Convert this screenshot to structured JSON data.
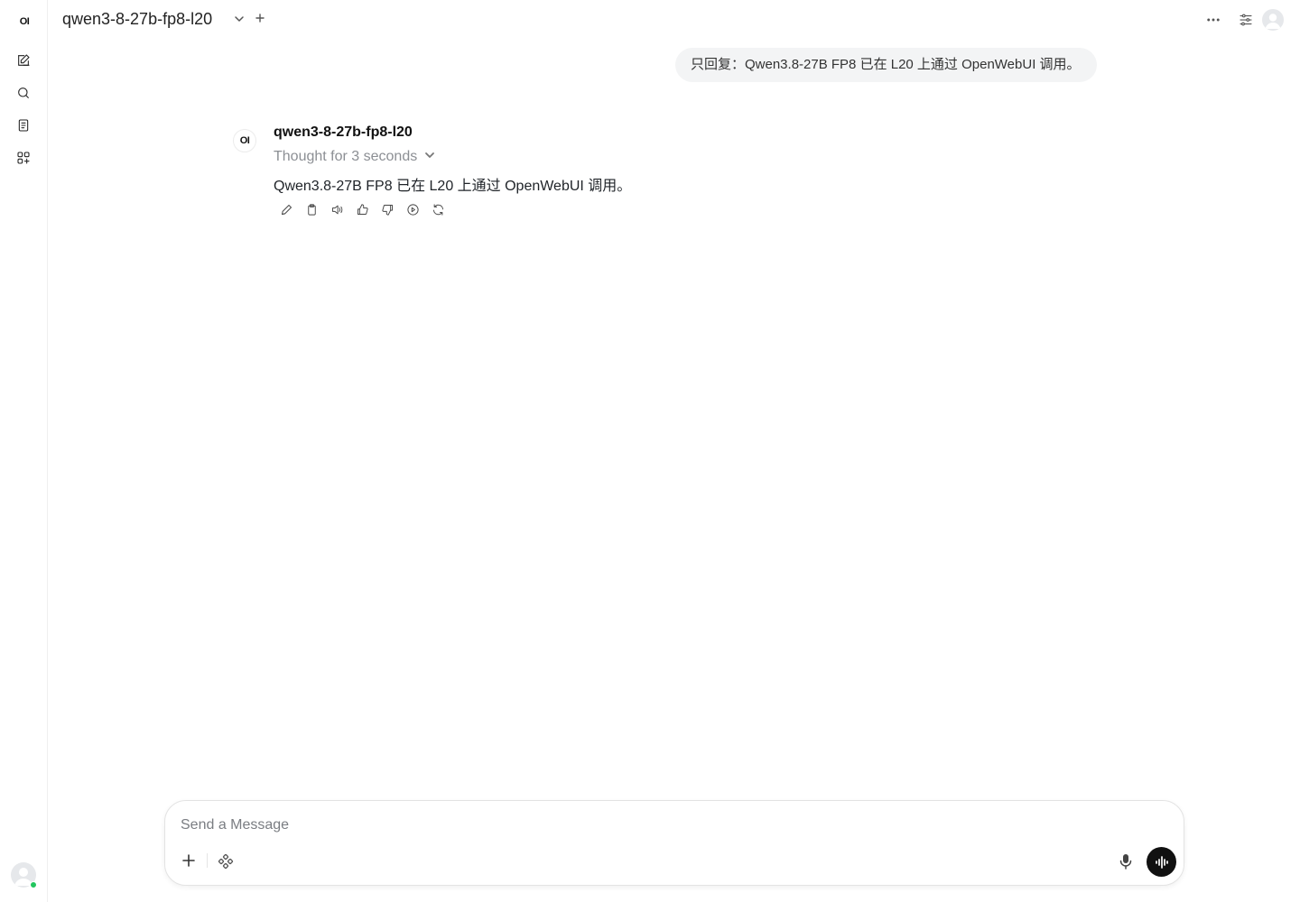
{
  "sidebar": {
    "logo": "OI",
    "icons": [
      "new-chat-icon",
      "search-icon",
      "notes-icon",
      "workspace-icon"
    ],
    "user_status_color": "#22c55e"
  },
  "header": {
    "model_name": "qwen3-8-27b-fp8-l20",
    "icons": [
      "chevron-down-icon",
      "plus-icon",
      "more-icon",
      "controls-icon",
      "user-avatar-icon"
    ]
  },
  "conversation": {
    "user_message": "只回复：Qwen3.8-27B FP8 已在 L20 上通过 OpenWebUI 调用。",
    "assistant": {
      "avatar_text": "OI",
      "model_name": "qwen3-8-27b-fp8-l20",
      "thought_label": "Thought for 3 seconds",
      "response": "Qwen3.8-27B FP8 已在 L20 上通过 OpenWebUI 调用。",
      "actions": [
        "edit-icon",
        "copy-icon",
        "read-aloud-icon",
        "thumbs-up-icon",
        "thumbs-down-icon",
        "continue-icon",
        "regenerate-icon"
      ]
    }
  },
  "composer": {
    "placeholder": "Send a Message",
    "value": "",
    "icons": [
      "plus-icon",
      "integrations-icon",
      "microphone-icon",
      "voice-mode-icon"
    ]
  },
  "colors": {
    "bubble_bg": "#f3f4f5",
    "accent_dark": "#111111",
    "muted_text": "#8c8f94"
  }
}
